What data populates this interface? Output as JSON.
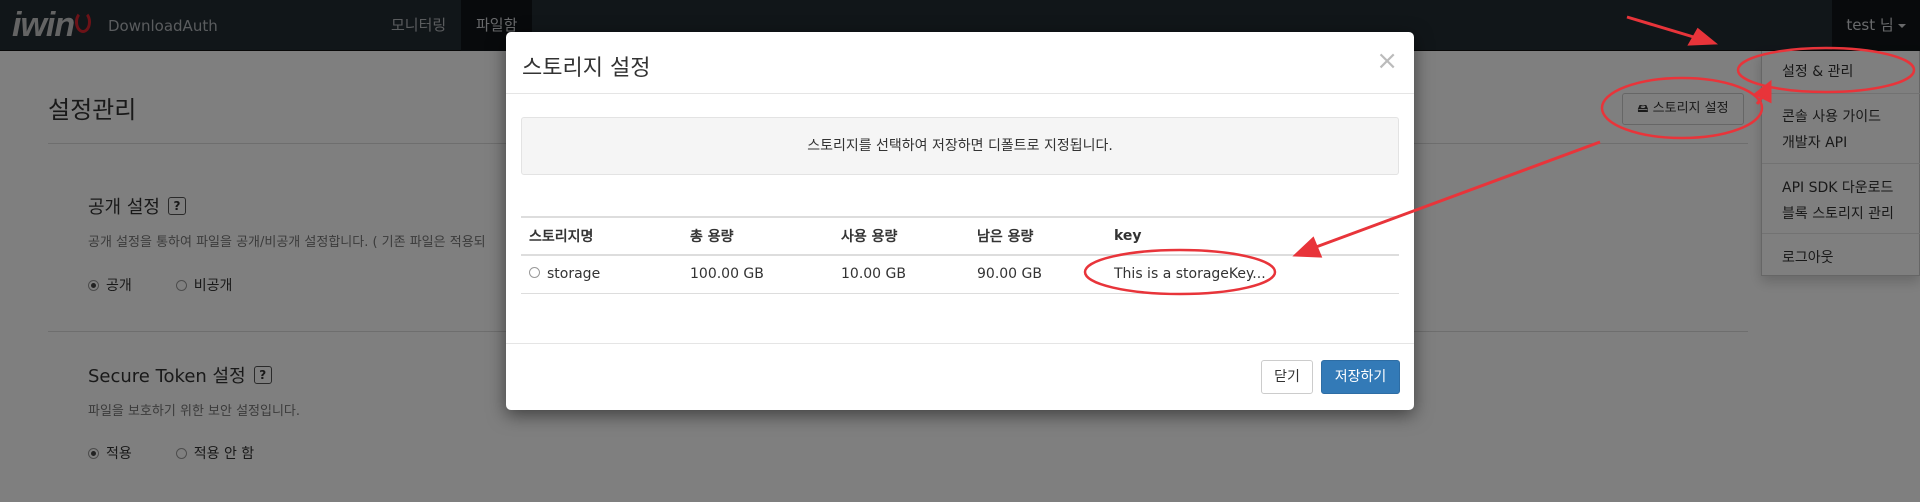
{
  "navbar": {
    "logo": "iwin",
    "brand": "DownloadAuth",
    "nav_items": [
      {
        "label": "모니터링"
      },
      {
        "label": "파일함"
      }
    ],
    "user_label": "test 님"
  },
  "dropdown": {
    "items": [
      {
        "label": "설정 & 관리"
      },
      {
        "label": "콘솔 사용 가이드"
      },
      {
        "label": "개발자 API"
      },
      {
        "label": "API SDK 다운로드"
      },
      {
        "label": "블록 스토리지 관리"
      },
      {
        "label": "로그아웃"
      }
    ]
  },
  "page": {
    "title": "설정관리",
    "storage_button": "스토리지 설정",
    "public_section": {
      "title": "공개 설정",
      "help": "?",
      "desc": "공개 설정을 통하여 파일을 공개/비공개 설정합니다. ( 기존 파일은 적용되",
      "options": [
        "공개",
        "비공개"
      ]
    },
    "token_section": {
      "title": "Secure Token 설정",
      "help": "?",
      "desc": "파일을 보호하기 위한 보안 설정입니다.",
      "options": [
        "적용",
        "적용 안 함"
      ]
    }
  },
  "modal": {
    "title": "스토리지 설정",
    "close_glyph": "×",
    "notice": "스토리지를 선택하여 저장하면 디폴트로 지정됩니다.",
    "columns": [
      "스토리지명",
      "총 용량",
      "사용 용량",
      "남은 용량",
      "key"
    ],
    "rows": [
      {
        "name": "storage",
        "total": "100.00 GB",
        "used": "10.00 GB",
        "remaining": "90.00 GB",
        "key": "This is a storageKey..."
      }
    ],
    "close_button": "닫기",
    "save_button": "저장하기"
  },
  "colors": {
    "navbar_bg": "#232c33",
    "primary": "#337ab7",
    "annotation": "#e8343a"
  }
}
